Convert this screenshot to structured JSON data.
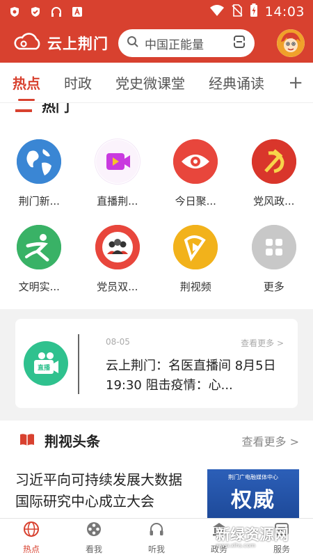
{
  "status_bar": {
    "time": "14:03"
  },
  "header": {
    "app_name": "云上荆门",
    "search_placeholder": "中国正能量"
  },
  "tabs": [
    {
      "label": "热点",
      "active": true
    },
    {
      "label": "时政"
    },
    {
      "label": "党史微课堂"
    },
    {
      "label": "经典诵读"
    }
  ],
  "tab_plus": "+",
  "hot_section": {
    "title": "热门",
    "items": [
      {
        "label": "荆门新...",
        "icon": "globe-icon",
        "color": "#3a86d4"
      },
      {
        "label": "直播荆...",
        "icon": "video-icon",
        "color": "#c93adf"
      },
      {
        "label": "今日聚...",
        "icon": "eye-icon",
        "color": "#e8463c"
      },
      {
        "label": "党风政...",
        "icon": "party-emblem-icon",
        "color": "#d9362b"
      },
      {
        "label": "文明实...",
        "icon": "runner-icon",
        "color": "#39b266"
      },
      {
        "label": "党员双...",
        "icon": "group-icon",
        "color": "#e8463c"
      },
      {
        "label": "荆视频",
        "icon": "play-icon",
        "color": "#f2b21b"
      },
      {
        "label": "更多",
        "icon": "grid-icon",
        "color": "#c8c8c8"
      }
    ]
  },
  "live_card": {
    "date": "08-05",
    "more": "查看更多 >",
    "text": "云上荆门：名医直播间 8月5日 19:30 阻击疫情：心...",
    "badge": "直播"
  },
  "news": {
    "title": "荆视头条",
    "more": "查看更多 >",
    "article_title": "习近平向可持续发展大数据国际研究中心成立大会",
    "thumb_small": "荆门广电融媒体中心",
    "thumb_big": "权威"
  },
  "bottom_nav": [
    {
      "label": "热点",
      "icon": "globe-nav-icon",
      "active": true
    },
    {
      "label": "看我",
      "icon": "film-reel-icon"
    },
    {
      "label": "听我",
      "icon": "headphones-icon"
    },
    {
      "label": "政务",
      "icon": "government-icon"
    },
    {
      "label": "服务",
      "icon": "service-icon"
    }
  ],
  "watermark": {
    "text": "新绿资源网",
    "sub": "www.xlhs.com"
  },
  "colors": {
    "brand": "#d8412f",
    "live_green": "#2fc18e"
  }
}
